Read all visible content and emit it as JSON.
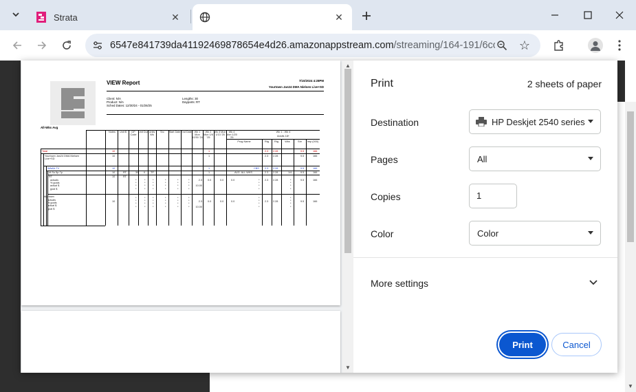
{
  "browser": {
    "tabs": [
      {
        "title": "Strata",
        "active": false
      },
      {
        "title": "",
        "active": true
      }
    ],
    "address": {
      "host": "6547e841739da41192469878654e4d26.amazonappstream.com",
      "path": "/streaming/164-191/6ccf..."
    },
    "icons": {
      "tab_search": "chevron-down-icon",
      "new_tab": "plus-icon",
      "minimize": "minimize-icon",
      "maximize": "maximize-icon",
      "close": "close-icon"
    }
  },
  "report": {
    "title": "VIEW Report",
    "date": "7/10/2024 4:28PM",
    "market": "Yourtown Jan24 DMA Nielsen Live+SD",
    "client": "Client: N/A",
    "product": "Product: N/A",
    "sched_dates": "Sched Dates: 12/30/24 - 01/26/25",
    "lengths": "Lengths: 30",
    "dayparts": "Dayparts: RT",
    "section": "All-Wks Avg",
    "headers": {
      "notes": "Notes",
      "unit_cost": "Unit $",
      "dp_code": "DP Code",
      "unit_dur": "Unit Dur",
      "units_wk": "Units Wk",
      "src": "Src",
      "start_date": "Start Date",
      "end_date": "End Date",
      "wk1": "Wk 1 Mon 12/30 '24",
      "wk2": "Wk 2 Mon 1/6 '25",
      "wk3": "Wk 3 Mon 1/13 '25",
      "wk4": "Wk 4 Mon 1/20 '25",
      "group": "Wk 1 - Wk 4",
      "demo": "Adults 18+",
      "prog_name": "Prog Name",
      "rtg": "Rtg",
      "rtg2": "Rtg",
      "wks": "Wks",
      "shr": "Shr",
      "imp": "Imp (000)"
    },
    "rows": {
      "total_label": "Total",
      "total_unit": "10",
      "total_wk1": "1",
      "total_r1": "2.3",
      "total_r2": "2.28",
      "total_shr": "9.5",
      "total_imp": "166",
      "mkt_label": "Yourtown Jan24 DMA Nielsen Live+SD",
      "mkt_unit": "10",
      "mkt_wk1": "1",
      "mkt_r1": "2.3",
      "mkt_r2": "2.28",
      "mkt_shr": "9.5",
      "mkt_imp": "166",
      "stn_label": "WAAA-TV",
      "stn_unit": "10",
      "stn_wk1": "1",
      "stn_net": "CBS",
      "stn_r1": "2.3",
      "stn_r2": "2.28",
      "stn_shr": "9.5",
      "stn_imp": "166",
      "dp_label": "M-Su 5p-7p",
      "dp_unit": "10",
      "dp_code": "RT",
      "dp_dur": "30",
      "dp_units": "0",
      "dp_src": "TP",
      "dp_wk1": "1",
      "dp_prog": "AVG. ALL WKS",
      "dp_r1": "2.3",
      "dp_r2": "2.28",
      "dp_wks": "1/4",
      "dp_shr": "9.5",
      "dp_imp": "166",
      "rt_label": "RT",
      "rt_unit": "10",
      "rt_code": "RT",
      "rt_subs": "actuals\n% goals\nactual $\ngoal $",
      "rt_wk1": "2.3\n\n10.00",
      "rt_wk2": "0.0",
      "rt_wk3": "0.0",
      "rt_wk4": "0.0",
      "rt_r1": "2.3",
      "rt_r2": "2.28",
      "rt_shr": "9.5",
      "rt_imp": "166",
      "yt_label": "Yourtown",
      "yt_subs": "actuals\n% goals\nactual $\ngoal $",
      "yt_unit": "10",
      "yt_wk1": "2.3\n\n10.00",
      "yt_wk2": "0.0",
      "yt_wk3": "0.0",
      "yt_wk4": "0.0",
      "yt_r1": "2.3",
      "yt_r2": "2.28",
      "yt_shr": "9.5",
      "yt_imp": "166",
      "star_col": "*\n*\n*\n*"
    }
  },
  "print": {
    "title": "Print",
    "sheets": "2 sheets of paper",
    "destination_label": "Destination",
    "destination_value": "HP Deskjet 2540 series",
    "pages_label": "Pages",
    "pages_value": "All",
    "copies_label": "Copies",
    "copies_value": "1",
    "color_label": "Color",
    "color_value": "Color",
    "more_settings": "More settings",
    "print_button": "Print",
    "cancel_button": "Cancel"
  },
  "colors": {
    "tabstrip_bg": "#dfe6f0",
    "omnibox_bg": "#e9eef6",
    "primary_button": "#0b57d0",
    "page_dark_bg": "#2e2e2e",
    "report_red": "#cc0000",
    "report_blue": "#1a3ccc"
  }
}
